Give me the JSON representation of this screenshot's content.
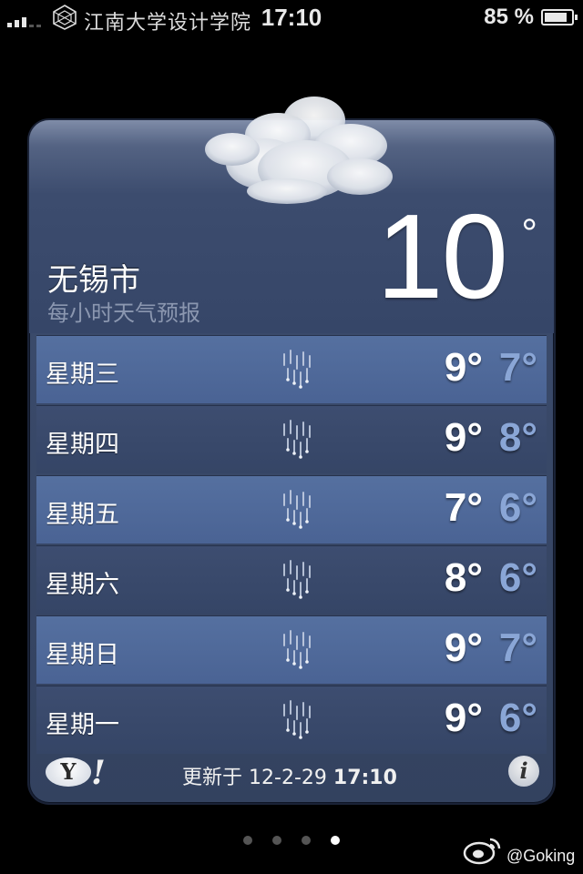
{
  "status_bar": {
    "carrier": "江南大学设计学院",
    "time": "17:10",
    "battery_percent": "85 %",
    "battery_level": 0.85,
    "signal_bars": 3
  },
  "weather": {
    "city": "无锡市",
    "subtitle": "每小时天气预报",
    "current_temp": "10",
    "degree_symbol": "°",
    "forecast": [
      {
        "day": "星期三",
        "high": "9°",
        "low": "7°",
        "icon": "rain-icon"
      },
      {
        "day": "星期四",
        "high": "9°",
        "low": "8°",
        "icon": "rain-icon"
      },
      {
        "day": "星期五",
        "high": "7°",
        "low": "6°",
        "icon": "rain-icon"
      },
      {
        "day": "星期六",
        "high": "8°",
        "low": "6°",
        "icon": "rain-icon"
      },
      {
        "day": "星期日",
        "high": "9°",
        "low": "7°",
        "icon": "rain-icon"
      },
      {
        "day": "星期一",
        "high": "9°",
        "low": "6°",
        "icon": "rain-icon"
      }
    ],
    "footer": {
      "yahoo_letter": "Y",
      "yahoo_bang": "!",
      "updated_label": "更新于",
      "updated_date": "12-2-29",
      "updated_time": "17:10",
      "info_symbol": "i"
    }
  },
  "page_dots": {
    "count": 4,
    "active_index": 3
  },
  "watermark": "@Goking",
  "colors": {
    "background": "#000000",
    "row_odd": "#5570a0",
    "row_even": "#3d4d70",
    "low_temp": "#8aa6d6"
  }
}
